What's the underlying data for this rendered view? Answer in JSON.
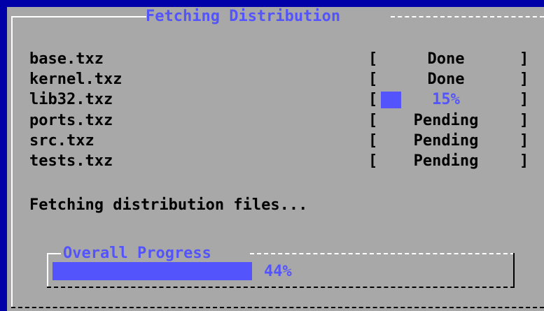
{
  "dialog": {
    "title": "Fetching Distribution"
  },
  "files": [
    {
      "name": "base.txz",
      "status": "Done",
      "state": "done",
      "progress": 1.0
    },
    {
      "name": "kernel.txz",
      "status": "Done",
      "state": "done",
      "progress": 1.0
    },
    {
      "name": "lib32.txz",
      "status": "15%",
      "state": "downloading",
      "progress": 0.15
    },
    {
      "name": "ports.txz",
      "status": "Pending",
      "state": "pending",
      "progress": 0
    },
    {
      "name": "src.txz",
      "status": "Pending",
      "state": "pending",
      "progress": 0
    },
    {
      "name": "tests.txz",
      "status": "Pending",
      "state": "pending",
      "progress": 0
    }
  ],
  "brackets": {
    "open": "[",
    "close": "]"
  },
  "message": "Fetching distribution files...",
  "overall": {
    "title": "Overall Progress",
    "percent_label": "44%",
    "progress": 0.44
  },
  "colors": {
    "background": "#0000a8",
    "dialog": "#a8a8a8",
    "accent": "#5454fc",
    "text": "#000000",
    "highlight": "#ffffff"
  }
}
